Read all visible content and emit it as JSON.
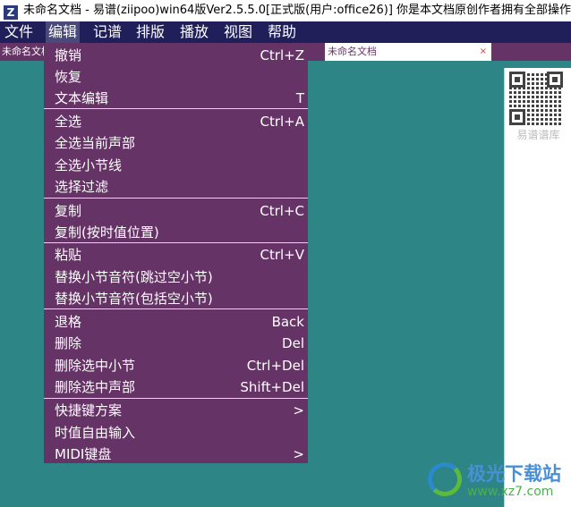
{
  "window": {
    "logo": "Z",
    "title": "未命名文档 - 易谱(ziipoo)win64版Ver2.5.5.0[正式版(用户:office26)] 你是本文档原创作者拥有全部操作权限-success"
  },
  "menubar": [
    "文件",
    "编辑",
    "记谱",
    "排版",
    "播放",
    "视图",
    "帮助"
  ],
  "tabs": [
    {
      "label": "未命名文档"
    },
    {
      "label": "未命名文档",
      "close": "×"
    }
  ],
  "side": {
    "qr_label": "易谱谱库"
  },
  "edit_menu": [
    {
      "label": "撤销",
      "shortcut": "Ctrl+Z"
    },
    {
      "label": "恢复",
      "shortcut": ""
    },
    {
      "label": "文本编辑",
      "shortcut": "T"
    },
    {
      "label": "全选",
      "shortcut": "Ctrl+A"
    },
    {
      "label": "全选当前声部",
      "shortcut": ""
    },
    {
      "label": "全选小节线",
      "shortcut": ""
    },
    {
      "label": "选择过滤",
      "shortcut": ""
    },
    {
      "label": "复制",
      "shortcut": "Ctrl+C"
    },
    {
      "label": "复制(按时值位置)",
      "shortcut": ""
    },
    {
      "label": "粘贴",
      "shortcut": "Ctrl+V"
    },
    {
      "label": "替换小节音符(跳过空小节)",
      "shortcut": ""
    },
    {
      "label": "替换小节音符(包括空小节)",
      "shortcut": ""
    },
    {
      "label": "退格",
      "shortcut": "Back"
    },
    {
      "label": "删除",
      "shortcut": "Del"
    },
    {
      "label": "删除选中小节",
      "shortcut": "Ctrl+Del"
    },
    {
      "label": "删除选中声部",
      "shortcut": "Shift+Del"
    },
    {
      "label": "快捷键方案",
      "shortcut": ">"
    },
    {
      "label": "时值自由输入",
      "shortcut": ""
    },
    {
      "label": "MIDI键盘",
      "shortcut": ">"
    }
  ],
  "watermark": {
    "name": "极光下载站",
    "url": "www.xz7.com"
  }
}
